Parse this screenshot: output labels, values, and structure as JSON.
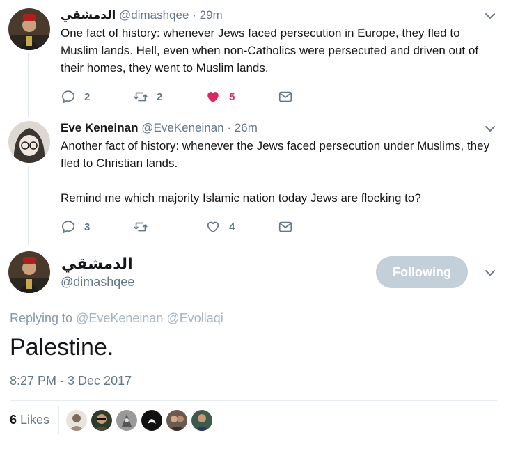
{
  "tweets": [
    {
      "name": "الدمشقي",
      "handle": "@dimashqee",
      "sep": "·",
      "time": "29m",
      "text": [
        "One fact of history: whenever Jews faced persecution in Europe, they fled to Muslim lands. Hell, even when non-Catholics were persecuted and driven out of their homes, they went to Muslim lands."
      ],
      "replies": "2",
      "retweets": "2",
      "likes": "5"
    },
    {
      "name": "Eve Keneinan",
      "handle": "@EveKeneinan",
      "sep": "·",
      "time": "26m",
      "text": [
        "Another fact of history: whenever the Jews faced persecution under Muslims, they fled to Christian lands.",
        "Remind me which majority Islamic nation today Jews are flocking to?"
      ],
      "replies": "3",
      "retweets": "",
      "likes": "4"
    }
  ],
  "main_tweet": {
    "name": "الدمشقي",
    "handle": "@dimashqee",
    "follow_label": "Following",
    "replying_prefix": "Replying to",
    "replying_to": [
      "@EveKeneinan",
      "@Evollaqi"
    ],
    "text": "Palestine.",
    "timestamp": "8:27 PM - 3 Dec 2017",
    "likes_count": "6",
    "likes_label": "Likes"
  },
  "icons": {
    "reply": "reply-icon",
    "retweet": "retweet-icon",
    "like": "heart-icon",
    "message": "envelope-icon",
    "caret": "chevron-down-icon"
  },
  "colors": {
    "like_active": "#e0245e",
    "icon_gray": "#657786",
    "follow_button": "#c3cfd9"
  }
}
